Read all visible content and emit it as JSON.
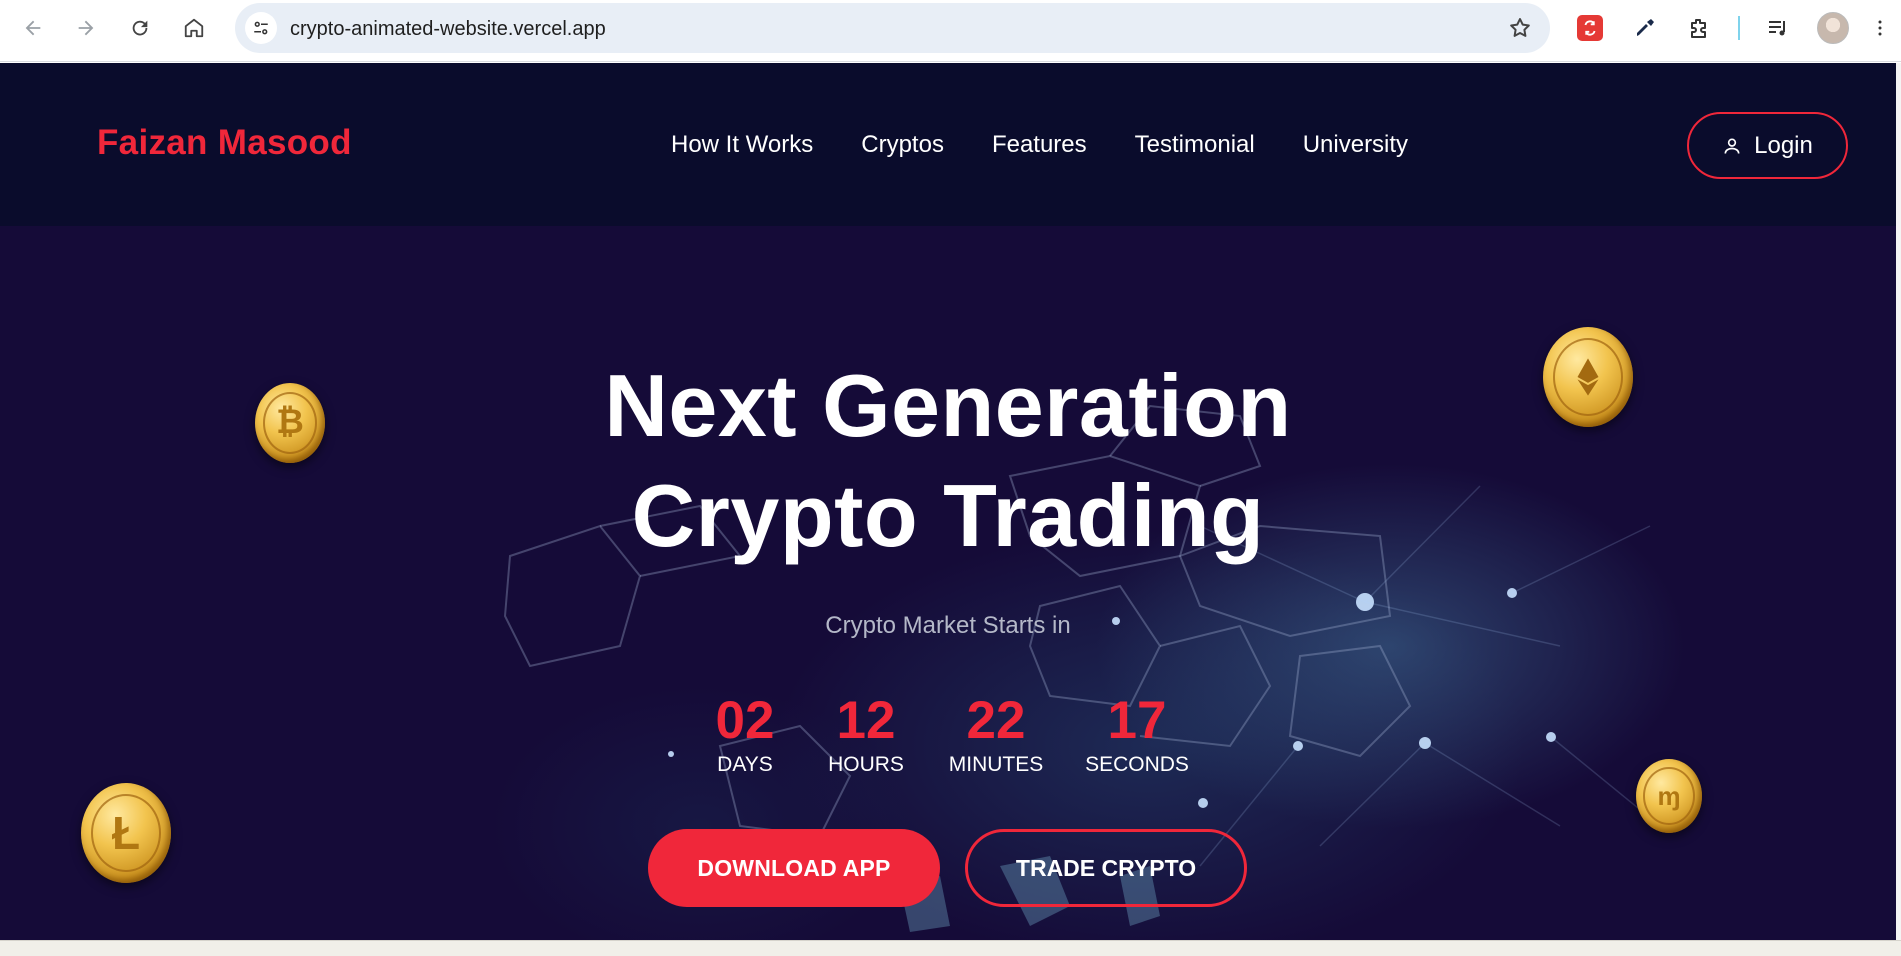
{
  "browser": {
    "url": "crypto-animated-website.vercel.app"
  },
  "site": {
    "brand": "Faizan Masood",
    "nav": [
      "How It Works",
      "Cryptos",
      "Features",
      "Testimonial",
      "University"
    ],
    "login_label": "Login"
  },
  "hero": {
    "title_line1": "Next Generation",
    "title_line2": "Crypto Trading",
    "subtitle": "Crypto Market Starts in",
    "countdown": [
      {
        "value": "02",
        "label": "DAYS"
      },
      {
        "value": "12",
        "label": "HOURS"
      },
      {
        "value": "22",
        "label": "MINUTES"
      },
      {
        "value": "17",
        "label": "SECONDS"
      }
    ],
    "download_label": "DOWNLOAD APP",
    "trade_label": "TRADE CRYPTO",
    "coins": [
      "bitcoin-coin",
      "ethereum-coin",
      "litecoin-coin",
      "monero-coin"
    ]
  },
  "colors": {
    "accent": "#f0273a",
    "header_bg": "#0a0c2c",
    "hero_bg": "#150b38"
  }
}
